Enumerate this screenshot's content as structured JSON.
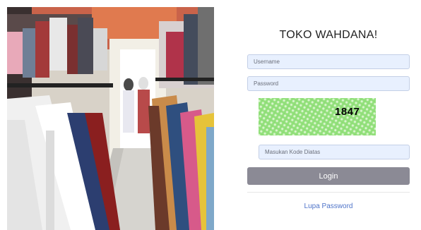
{
  "store": {
    "title": "TOKO WAHDANA!"
  },
  "photo": {
    "description_icon": "clothing-store-photo"
  },
  "login_form": {
    "username_placeholder": "Username",
    "username_value": "",
    "password_placeholder": "Password",
    "password_value": "",
    "captcha_code": "1847",
    "captcha_placeholder": "Masukan Kode Diatas",
    "captcha_value": "",
    "login_label": "Login",
    "forgot_label": "Lupa Password"
  },
  "colors": {
    "field_background": "#e8f0fe",
    "button_background": "#8b8a95",
    "captcha_background": "#93e07c",
    "link": "#4f74c9"
  }
}
